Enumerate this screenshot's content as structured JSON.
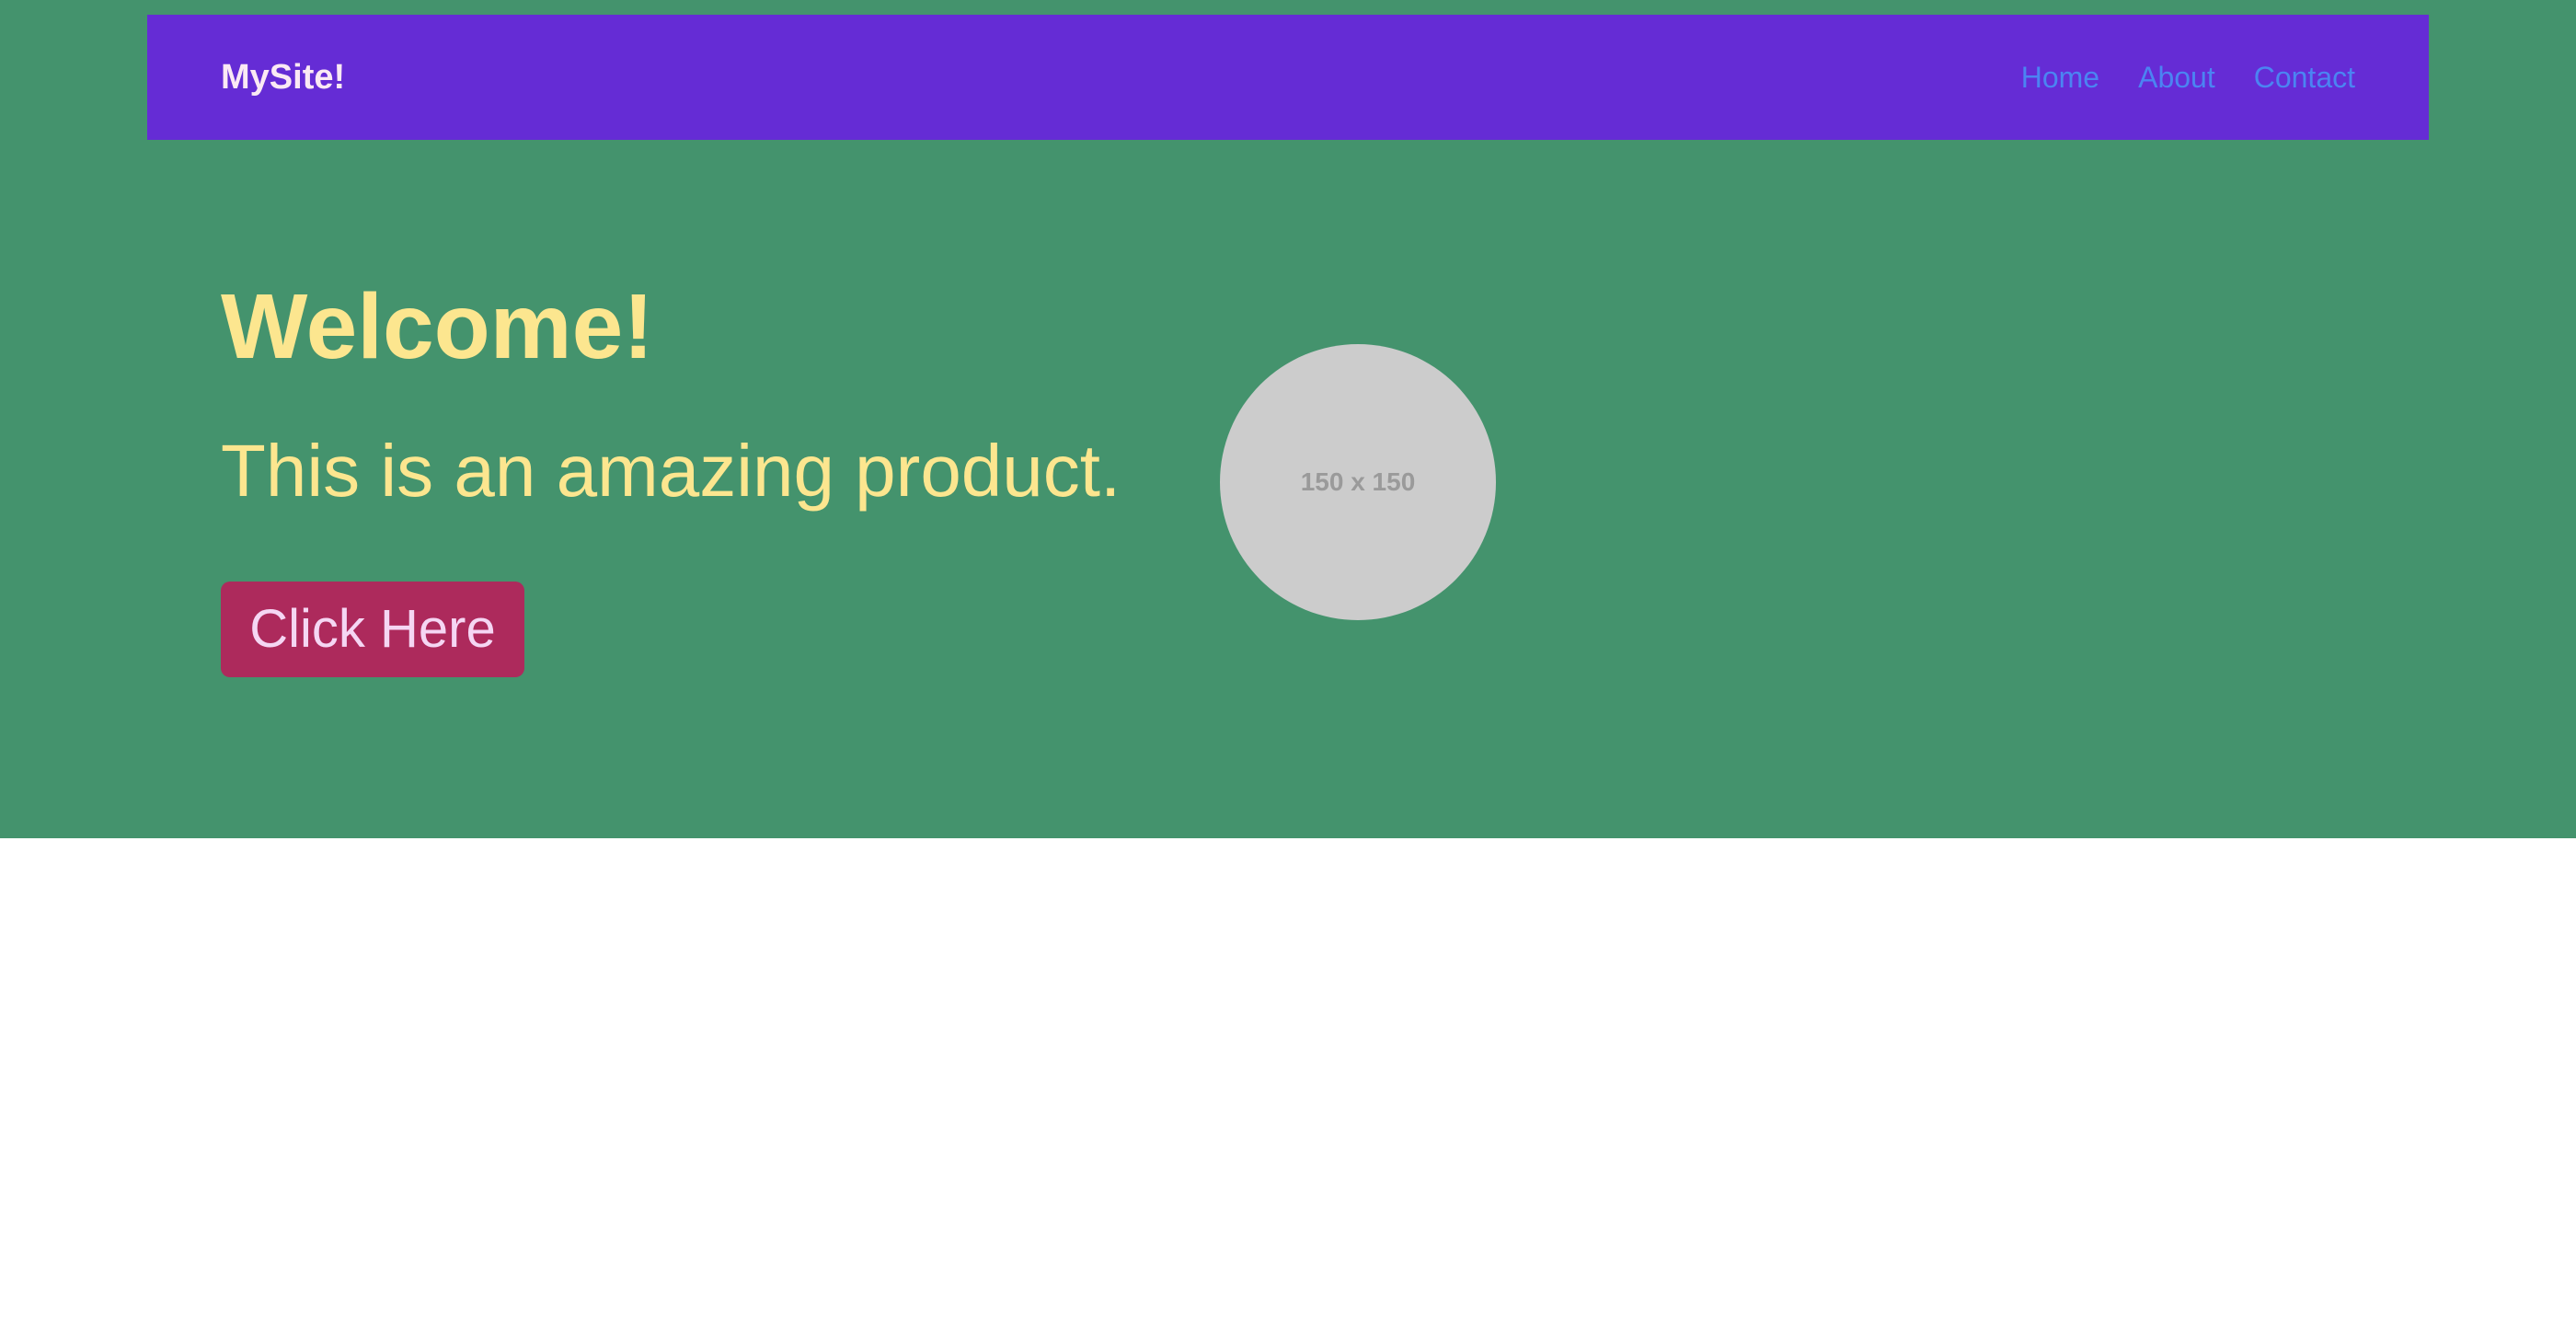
{
  "navbar": {
    "brand": "MySite!",
    "links": [
      {
        "label": "Home"
      },
      {
        "label": "About"
      },
      {
        "label": "Contact"
      }
    ]
  },
  "hero": {
    "title": "Welcome!",
    "subtitle": "This is an amazing product.",
    "cta_label": "Click Here",
    "image_placeholder_text": "150 x 150"
  },
  "colors": {
    "hero_background": "#44936d",
    "navbar_background": "#652cd5",
    "brand_text": "#fbe9f4",
    "nav_link": "#4b84f2",
    "hero_text": "#fce68f",
    "button_background": "#ad2a5c",
    "button_text": "#f5d6f3",
    "placeholder_background": "#cccccc",
    "placeholder_text": "#9a9a9a",
    "page_background": "#ffffff"
  }
}
